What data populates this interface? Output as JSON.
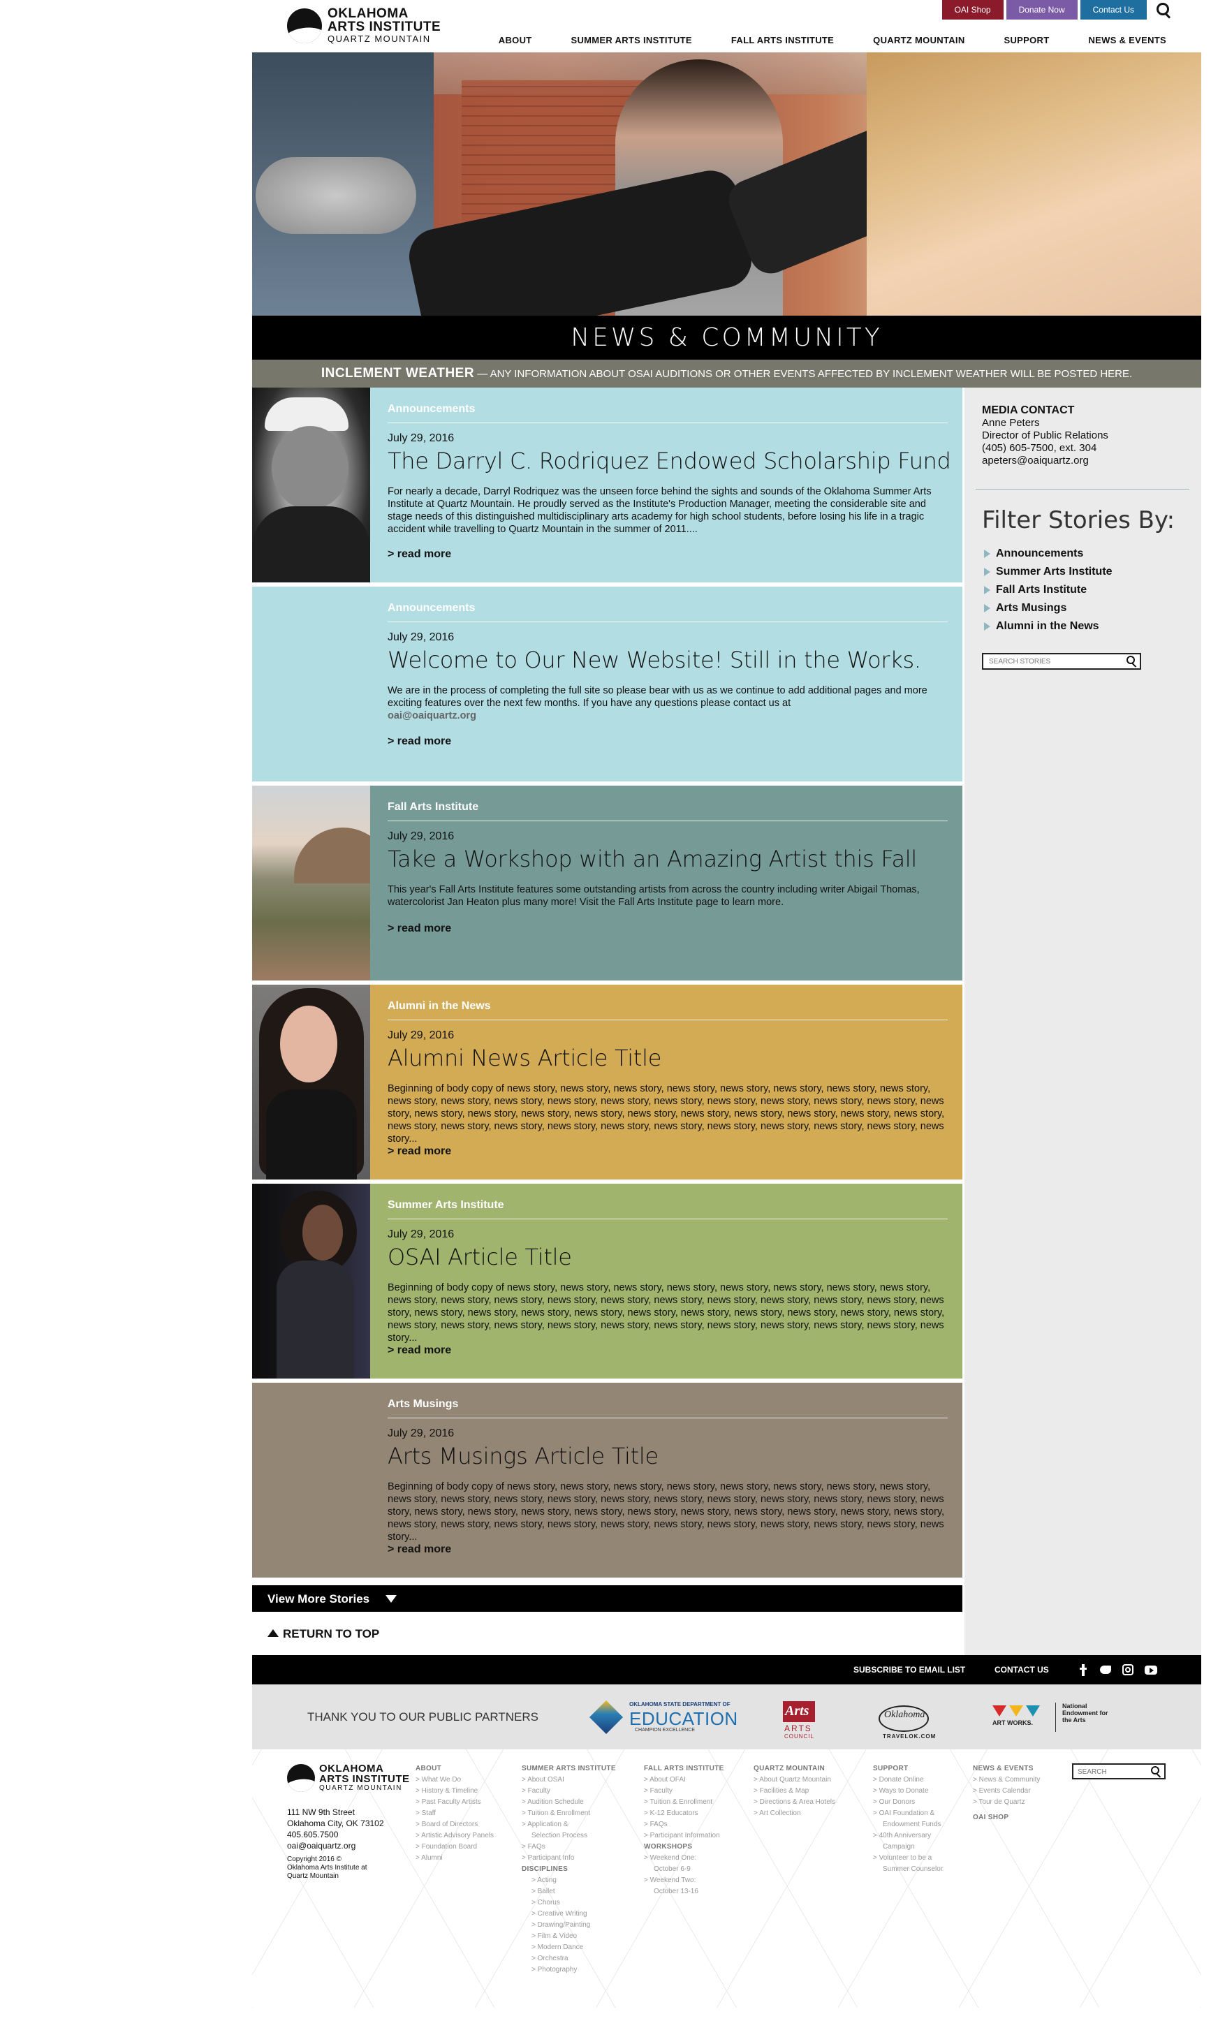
{
  "header": {
    "logo": {
      "line1": "OKLAHOMA",
      "line2": "ARTS INSTITUTE",
      "line3": "QUARTZ MOUNTAIN"
    },
    "util_buttons": [
      {
        "label": "OAI Shop",
        "color": "#8b1a2b"
      },
      {
        "label": "Donate Now",
        "color": "#7b5aa6"
      },
      {
        "label": "Contact Us",
        "color": "#1e6fa0"
      }
    ],
    "nav": [
      "ABOUT",
      "SUMMER ARTS INSTITUTE",
      "FALL ARTS INSTITUTE",
      "QUARTZ MOUNTAIN",
      "SUPPORT",
      "NEWS & EVENTS"
    ]
  },
  "banner": {
    "title": "NEWS & COMMUNITY"
  },
  "weather": {
    "bold": "INCLEMENT WEATHER",
    "text": " — ANY INFORMATION ABOUT OSAI AUDITIONS OR OTHER EVENTS AFFECTED BY INCLEMENT WEATHER WILL BE POSTED HERE."
  },
  "sidebar": {
    "media_contact": {
      "heading": "MEDIA CONTACT",
      "name": "Anne Peters",
      "role": "Director of Public Relations",
      "phone": "(405) 605-7500, ext. 304",
      "email": "apeters@oaiquartz.org"
    },
    "filter_heading": "Filter Stories By:",
    "filters": [
      "Announcements",
      "Summer Arts Institute",
      "Fall Arts Institute",
      "Arts Musings",
      "Alumni in the News"
    ],
    "search_placeholder": "SEARCH STORIES"
  },
  "stories": [
    {
      "category": "Announcements",
      "date": "July 29, 2016",
      "title": "The Darryl C. Rodriquez Endowed Scholarship Fund",
      "text": "For nearly a decade, Darryl Rodriquez was the unseen force behind the sights and sounds of the Oklahoma Summer Arts Institute at Quartz Mountain. He proudly served as the Institute's Production Manager, meeting the considerable site and stage needs of this distinguished multidisciplinary arts academy for high school students, before losing his life in a tragic accident while travelling to Quartz Mountain in the summer of 2011....",
      "more": "> read more",
      "bg": "#b1dde3"
    },
    {
      "category": "Announcements",
      "date": "July 29, 2016",
      "title": "Welcome to Our New Website! Still in the Works.",
      "text": "We are in the process of completing the full site so please bear with us as we continue to add additional pages and more exciting features over the next few months. If you have any questions please contact us at",
      "email": "oai@oaiquartz.org",
      "more": "> read more",
      "bg": "#b1dde3"
    },
    {
      "category": "Fall Arts Institute",
      "date": "July 29, 2016",
      "title": "Take a Workshop with an Amazing Artist this Fall",
      "text": "This year's Fall Arts Institute features some outstanding artists from across the country including writer Abigail Thomas, watercolorist Jan Heaton plus many more! Visit the Fall Arts Institute page to learn more.",
      "more": "> read more",
      "bg": "#769b97"
    },
    {
      "category": "Alumni in the News",
      "date": "July 29, 2016",
      "title": "Alumni News Article Title",
      "text": "Beginning of body copy of news story, news story, news story, news story, news story, news story, news story, news story, news story, news story, news story, news story, news story, news story, news story, news story, news story, news story, news story, news story, news story, news story, news story, news story, news story, news story, news story, news story, news story, news story, news story, news story, news story, news story, news story, news story, news story, news story, news story, news story...",
      "more": "> read more",
      "bg": "#d3ab55"
    },
    {
      "category": "Summer Arts Institute",
      "date": "July 29, 2016",
      "title": "OSAI Article Title",
      "text": "Beginning of body copy of news story, news story, news story, news story, news story, news story, news story, news story, news story, news story, news story, news story, news story, news story, news story, news story, news story, news story, news story, news story, news story, news story, news story, news story, news story, news story, news story, news story, news story, news story, news story, news story, news story, news story, news story, news story, news story, news story, news story, news story...",
      "more": "> read more",
      "bg": "#a0b46e"
    },
    {
      "category": "Arts Musings",
      "date": "July 29, 2016",
      "title": "Arts Musings Article Title",
      "text": "Beginning of body copy of news story, news story, news story, news story, news story, news story, news story, news story, news story, news story, news story, news story, news story, news story, news story, news story, news story, news story, news story, news story, news story, news story, news story, news story, news story, news story, news story, news story, news story, news story, news story, news story, news story, news story, news story, news story, news story, news story, news story, news story...",
      "more": "> read more",
      "bg": "#948674"
    }
  ],
  "view_more": "View More Stories",
  "return_top": "RETURN TO TOP",
  "footer_bar": {
    "subscribe": "SUBSCRIBE TO EMAIL LIST",
    "contact": "CONTACT US"
  },
  "partners": {
    "heading": "THANK YOU TO OUR PUBLIC PARTNERS",
    "edu_line1": "OKLAHOMA STATE DEPARTMENT OF",
    "edu_line2": "EDUCATION",
    "edu_line3": "CHAMPION EXCELLENCE",
    "oac_line1": "Arts",
    "oac_line2": "ARTS",
    "oac_line3": "COUNCIL",
    "travel_script": "Oklahoma",
    "travel_line": "TRAVELOK.COM",
    "nea_line1": "ART WORKS.",
    "nea_line2": "National Endowment for the Arts"
  },
  "footer": {
    "address": [
      "111 NW 9th Street",
      "Oklahoma City, OK 73102",
      "405.605.7500",
      "oai@oaiquartz.org"
    ],
    "copyright": "Copyright 2016 © Oklahoma Arts Institute at Quartz Mountain",
    "search_placeholder": "SEARCH",
    "columns": {
      "about": {
        "heading": "ABOUT",
        "items": [
          "> What We Do",
          "> History & Timeline",
          "> Past Faculty Artists",
          "> Staff",
          "> Board of Directors",
          "> Artistic Advisory Panels",
          "> Foundation Board",
          "> Alumni"
        ]
      },
      "summer": {
        "heading": "SUMMER ARTS INSTITUTE",
        "items": [
          "> About OSAI",
          "> Faculty",
          "> Audition Schedule",
          "> Tuition & Enrollment",
          "> Application &",
          "Selection Process",
          "> FAQs",
          "> Participant Info"
        ],
        "sub_heading": "DISCIPLINES",
        "sub_items": [
          "> Acting",
          "> Ballet",
          "> Chorus",
          "> Creative Writing",
          "> Drawing/Painting",
          "> Film & Video",
          "> Modern Dance",
          "> Orchestra",
          "> Photography"
        ]
      },
      "fall": {
        "heading": "FALL ARTS INSTITUTE",
        "items": [
          "> About OFAI",
          "> Faculty",
          "> Tuition & Enrollment",
          "> K-12 Educators",
          "> FAQs",
          "> Participant Information"
        ],
        "sub_heading": "WORKSHOPS",
        "sub_items": [
          "> Weekend One:",
          "October 6-9",
          "> Weekend Two:",
          "October 13-16"
        ]
      },
      "quartz": {
        "heading": "QUARTZ MOUNTAIN",
        "items": [
          "> About Quartz Mountain",
          "> Facilities & Map",
          "> Directions & Area Hotels",
          "> Art Collection"
        ]
      },
      "support": {
        "heading": "SUPPORT",
        "items": [
          "> Donate Online",
          "> Ways to Donate",
          "> Our Donors",
          "> OAI Foundation &",
          "Endowment Funds",
          "> 40th Anniversary",
          "Campaign",
          "> Volunteer to be a",
          "Summer Counselor"
        ]
      },
      "news": {
        "heading": "NEWS & EVENTS",
        "items": [
          "> News & Community",
          "> Events Calendar",
          "> Tour de Quartz"
        ],
        "shop": "OAI SHOP"
      }
    }
  }
}
